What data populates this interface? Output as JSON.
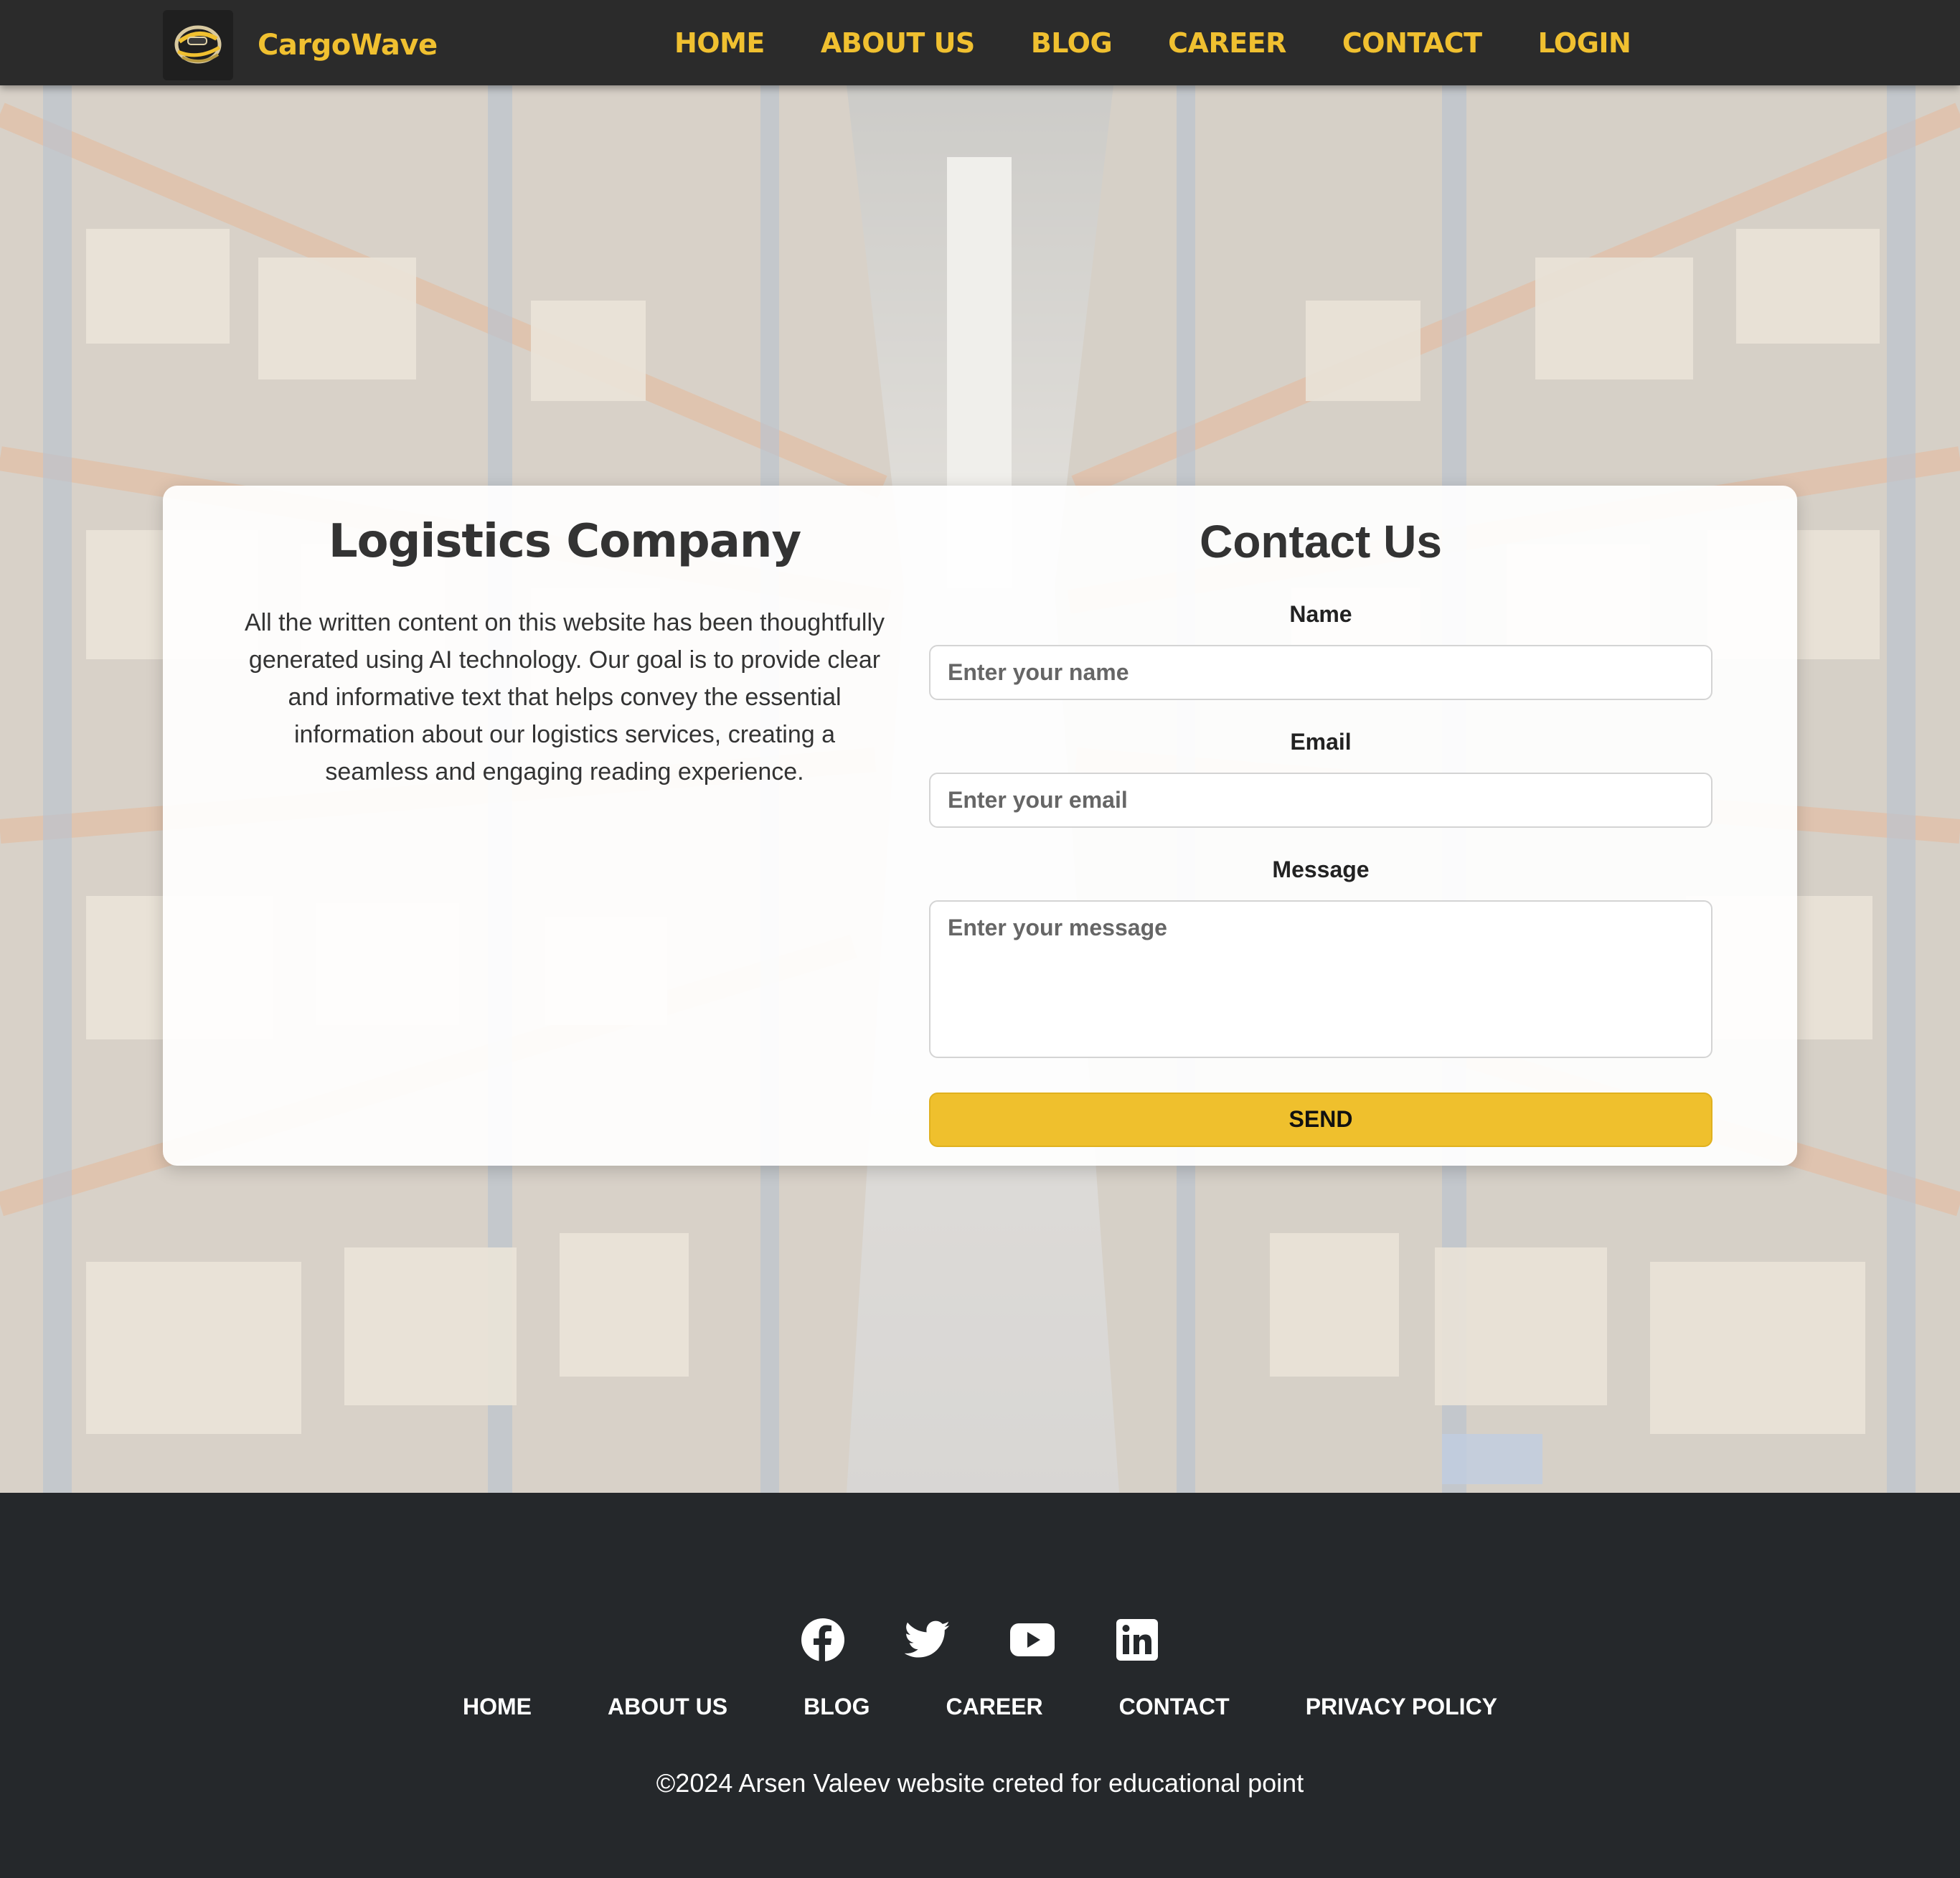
{
  "header": {
    "brand": "CargoWave",
    "nav": [
      "HOME",
      "ABOUT US",
      "BLOG",
      "CAREER",
      "CONTACT",
      "LOGIN"
    ]
  },
  "about": {
    "title": "Logistics Company",
    "text": "All the written content on this website has been thoughtfully generated using AI technology. Our goal is to provide clear and informative text that helps convey the essential information about our logistics services, creating a seamless and engaging reading experience."
  },
  "contact": {
    "title": "Contact Us",
    "name_label": "Name",
    "name_placeholder": "Enter your name",
    "email_label": "Email",
    "email_placeholder": "Enter your email",
    "message_label": "Message",
    "message_placeholder": "Enter your message",
    "send_label": "SEND"
  },
  "footer": {
    "social": [
      "facebook-icon",
      "twitter-icon",
      "youtube-icon",
      "linkedin-icon"
    ],
    "nav": [
      "HOME",
      "ABOUT US",
      "BLOG",
      "CAREER",
      "CONTACT",
      "PRIVACY POLICY"
    ],
    "copyright": "©2024 Arsen Valeev website creted for educational point"
  },
  "colors": {
    "accent": "#f0c030",
    "header_bg": "#2b2b2b",
    "footer_bg": "#25282b",
    "button": "#efc02d"
  }
}
